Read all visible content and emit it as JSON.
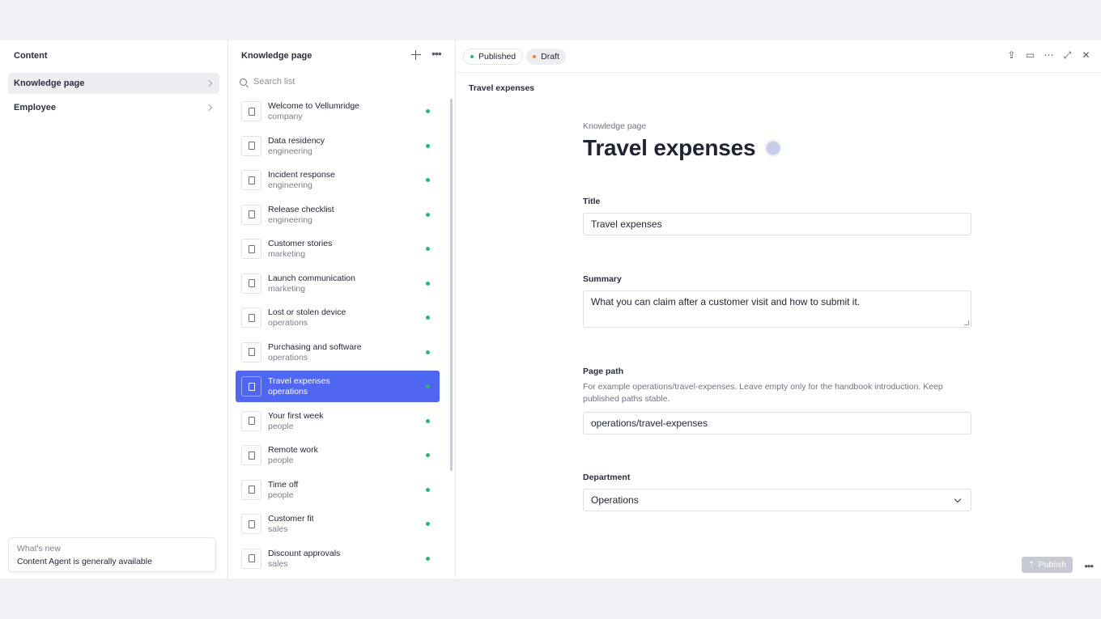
{
  "nav": {
    "title": "Content",
    "items": [
      {
        "label": "Knowledge page"
      },
      {
        "label": "Employee"
      }
    ],
    "whats_new": {
      "label": "What's new",
      "text": "Content Agent is generally available"
    }
  },
  "list": {
    "title": "Knowledge page",
    "search_placeholder": "Search list",
    "rows": [
      {
        "title": "Welcome to Vellumridge",
        "sub": "company"
      },
      {
        "title": "Data residency",
        "sub": "engineering"
      },
      {
        "title": "Incident response",
        "sub": "engineering"
      },
      {
        "title": "Release checklist",
        "sub": "engineering"
      },
      {
        "title": "Customer stories",
        "sub": "marketing"
      },
      {
        "title": "Launch communication",
        "sub": "marketing"
      },
      {
        "title": "Lost or stolen device",
        "sub": "operations"
      },
      {
        "title": "Purchasing and software",
        "sub": "operations"
      },
      {
        "title": "Travel expenses",
        "sub": "operations"
      },
      {
        "title": "Your first week",
        "sub": "people"
      },
      {
        "title": "Remote work",
        "sub": "people"
      },
      {
        "title": "Time off",
        "sub": "people"
      },
      {
        "title": "Customer fit",
        "sub": "sales"
      },
      {
        "title": "Discount approvals",
        "sub": "sales"
      }
    ]
  },
  "editor": {
    "status": {
      "published": "Published",
      "draft": "Draft"
    },
    "colors": {
      "published_dot": "#2bb673",
      "draft_dot": "#e8872f",
      "accent": "#4f66f0"
    },
    "breadcrumb": "Travel expenses",
    "eyebrow": "Knowledge page",
    "heading": "Travel expenses",
    "fields": {
      "title_label": "Title",
      "title_value": "Travel expenses",
      "summary_label": "Summary",
      "summary_value": "What you can claim after a customer visit and how to submit it.",
      "path_label": "Page path",
      "path_help": "For example operations/travel-expenses. Leave empty only for the handbook introduction. Keep published paths stable.",
      "path_value": "operations/travel-expenses",
      "department_label": "Department",
      "department_value": "Operations"
    },
    "publish_label": "Publish"
  }
}
